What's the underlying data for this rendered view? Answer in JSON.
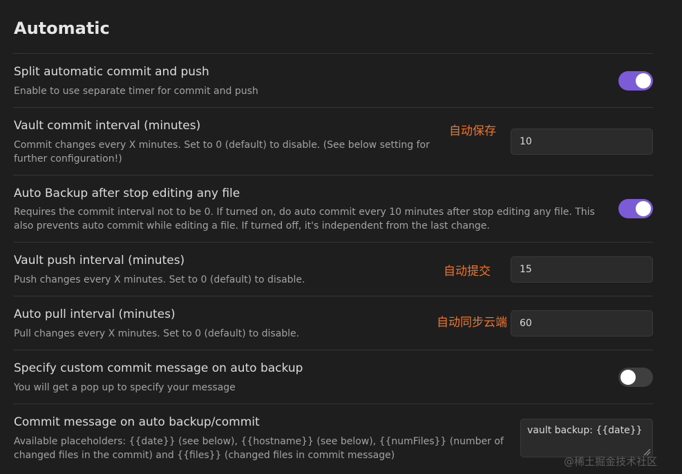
{
  "heading": "Automatic",
  "settings": {
    "split": {
      "name": "Split automatic commit and push",
      "desc": "Enable to use separate timer for commit and push",
      "enabled": true
    },
    "commit_interval": {
      "name": "Vault commit interval (minutes)",
      "desc": "Commit changes every X minutes. Set to 0 (default) to disable. (See below setting for further configuration!)",
      "value": "10"
    },
    "auto_backup": {
      "name": "Auto Backup after stop editing any file",
      "desc": "Requires the commit interval not to be 0. If turned on, do auto commit every 10 minutes after stop editing any file. This also prevents auto commit while editing a file. If turned off, it's independent from the last change.",
      "enabled": true
    },
    "push_interval": {
      "name": "Vault push interval (minutes)",
      "desc": "Push changes every X minutes. Set to 0 (default) to disable.",
      "value": "15"
    },
    "pull_interval": {
      "name": "Auto pull interval (minutes)",
      "desc": "Pull changes every X minutes. Set to 0 (default) to disable.",
      "value": "60"
    },
    "custom_message": {
      "name": "Specify custom commit message on auto backup",
      "desc": "You will get a pop up to specify your message",
      "enabled": false
    },
    "commit_message": {
      "name": "Commit message on auto backup/commit",
      "desc": "Available placeholders: {{date}} (see below), {{hostname}} (see below), {{numFiles}} (number of changed files in the commit) and {{files}} (changed files in commit message)",
      "value": "vault backup: {{date}}"
    }
  },
  "annotations": {
    "commit": "自动保存",
    "push": "自动提交",
    "pull": "自动同步云端"
  },
  "watermark": "@稀土掘金技术社区",
  "colors": {
    "accent": "#7c5cd6",
    "annotation": "#e8762b",
    "background": "#1e1e1e"
  }
}
